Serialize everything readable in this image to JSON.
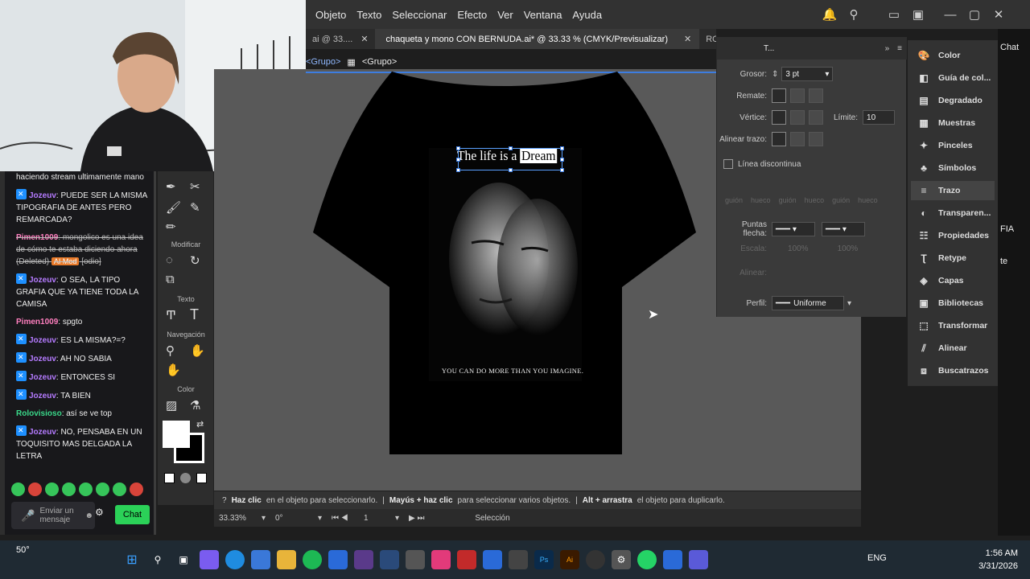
{
  "menubar": {
    "items": [
      "Objeto",
      "Texto",
      "Seleccionar",
      "Efecto",
      "Ver",
      "Ventana",
      "Ayuda"
    ]
  },
  "tabs": {
    "prev": "ai @ 33....",
    "active": "chaqueta y mono CON BERNUDA.ai* @ 33.33 % (CMYK/Previsualizar)",
    "next": "ROPA"
  },
  "breadcrumb": {
    "back": "<Grupo>",
    "current": "<Grupo>"
  },
  "chat": {
    "messages": [
      {
        "user": "",
        "text": "haciendo stream ultimamente mano",
        "style": "plain"
      },
      {
        "user": "Jozeuv",
        "text": ": PUEDE SER LA MISMA TIPOGRAFIA DE ANTES PERO REMARCADA?",
        "style": "purple"
      },
      {
        "user": "Pimen1009",
        "text": ": mongolico es una idea de cómo te estaba diciendo ahora (Deleted)",
        "style": "deleted",
        "mod": "AI Mod",
        "tag": "[odio]"
      },
      {
        "user": "Jozeuv",
        "text": ": O SEA, LA TIPO GRAFIA QUE YA TIENE TODA LA CAMISA",
        "style": "purple"
      },
      {
        "user": "Pimen1009",
        "text": ": spgto",
        "style": "pink"
      },
      {
        "user": "Jozeuv",
        "text": ": ES LA MISMA?=?",
        "style": "purple"
      },
      {
        "user": "Jozeuv",
        "text": ": AH NO SABIA",
        "style": "purple"
      },
      {
        "user": "Jozeuv",
        "text": ": ENTONCES SI",
        "style": "purple"
      },
      {
        "user": "Jozeuv",
        "text": ": TA BIEN",
        "style": "purple"
      },
      {
        "user": "Rolovisioso",
        "text": ": así se ve top",
        "style": "green"
      },
      {
        "user": "Jozeuv",
        "text": ": NO, PENSABA EN UN TOQUISITO MAS DELGADA LA LETRA",
        "style": "purple"
      }
    ],
    "input_placeholder": "Enviar un mensaje",
    "send_label": "Chat"
  },
  "tools": {
    "modificar": "Modificar",
    "texto": "Texto",
    "navegacion": "Navegación",
    "color": "Color"
  },
  "artwork": {
    "title_part1": "The life is a ",
    "title_part2": "Dream",
    "tagline": "YOU CAN DO MORE THAN YOU IMAGINE."
  },
  "stroke_panel": {
    "tab_label": "T...",
    "grosor_label": "Grosor:",
    "grosor_value": "3 pt",
    "remate_label": "Remate:",
    "vertice_label": "Vértice:",
    "limite_label": "Límite:",
    "limite_value": "10",
    "alinear_label": "Alinear trazo:",
    "discontinua_label": "Línea discontinua",
    "dash_labels": [
      "guión",
      "hueco",
      "guión",
      "hueco",
      "guión",
      "hueco"
    ],
    "puntas_label": "Puntas flecha:",
    "escala_label": "Escala:",
    "escala_values": [
      "100%",
      "100%"
    ],
    "alinear2_label": "Alinear:",
    "perfil_label": "Perfil:",
    "perfil_value": "Uniforme"
  },
  "dock": {
    "items": [
      "Color",
      "Guía de col...",
      "Degradado",
      "Muestras",
      "Pinceles",
      "Símbolos",
      "Trazo",
      "Transparen...",
      "Propiedades",
      "Retype",
      "Capas",
      "Bibliotecas",
      "Transformar",
      "Alinear",
      "Buscatrazos"
    ],
    "selected": "Trazo"
  },
  "right_strip": {
    "chat": "Chat",
    "fia": "FIA",
    "te": "te"
  },
  "hint": {
    "p1b": "Haz clic",
    "p1": "en el objeto para seleccionarlo.",
    "p2b": "Mayús + haz clic",
    "p2": "para seleccionar varios objetos.",
    "p3b": "Alt + arrastra",
    "p3": "el objeto para duplicarlo."
  },
  "status": {
    "zoom": "33.33%",
    "rotation": "0°",
    "artboard": "1",
    "mode": "Selección"
  },
  "taskbar": {
    "weather": "50°",
    "lang": "ENG",
    "time": "1:56 AM",
    "date": "3/31/2026"
  }
}
